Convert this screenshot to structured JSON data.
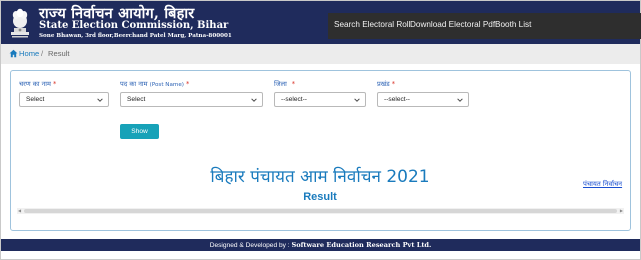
{
  "header": {
    "title_hindi": "राज्य निर्वाचन आयोग, बिहार",
    "title_english": "State Election Commission, Bihar",
    "address": "Sone Bhawan, 3rd floor,Beerchand Patel Marg, Patna-800001",
    "emblem_icon": "national-emblem-icon"
  },
  "nav": {
    "items": [
      {
        "label": "Search Electoral Roll"
      },
      {
        "label": "Download Electoral Pdf"
      },
      {
        "label": "Booth List"
      }
    ]
  },
  "breadcrumb": {
    "home_icon": "home-icon",
    "home": "Home",
    "separator": "/",
    "current": "Result"
  },
  "form": {
    "fields": [
      {
        "label": "चरण का नाम",
        "required": "*",
        "value": "Select"
      },
      {
        "label": "पद का नाम",
        "sublabel": "(Post Name)",
        "required": "*",
        "value": "Select"
      },
      {
        "label": "जिला",
        "required": "*",
        "value": "--select--"
      },
      {
        "label": "प्रखंड",
        "required": "*",
        "value": "--select--"
      }
    ],
    "show_label": "Show"
  },
  "result": {
    "title": "बिहार पंचायत आम निर्वाचन 2021",
    "subtitle": "Result",
    "side_link": "पंचायत निर्वाचन"
  },
  "footer": {
    "lead": "Designed & Developed by : ",
    "org": "Software Education Research Pvt Ltd."
  },
  "colors": {
    "header_bg": "#1f2b5c",
    "nav_bg": "#2e2e2e",
    "accent": "#1a7bbd",
    "button": "#17a2b8",
    "required": "#d93025"
  }
}
